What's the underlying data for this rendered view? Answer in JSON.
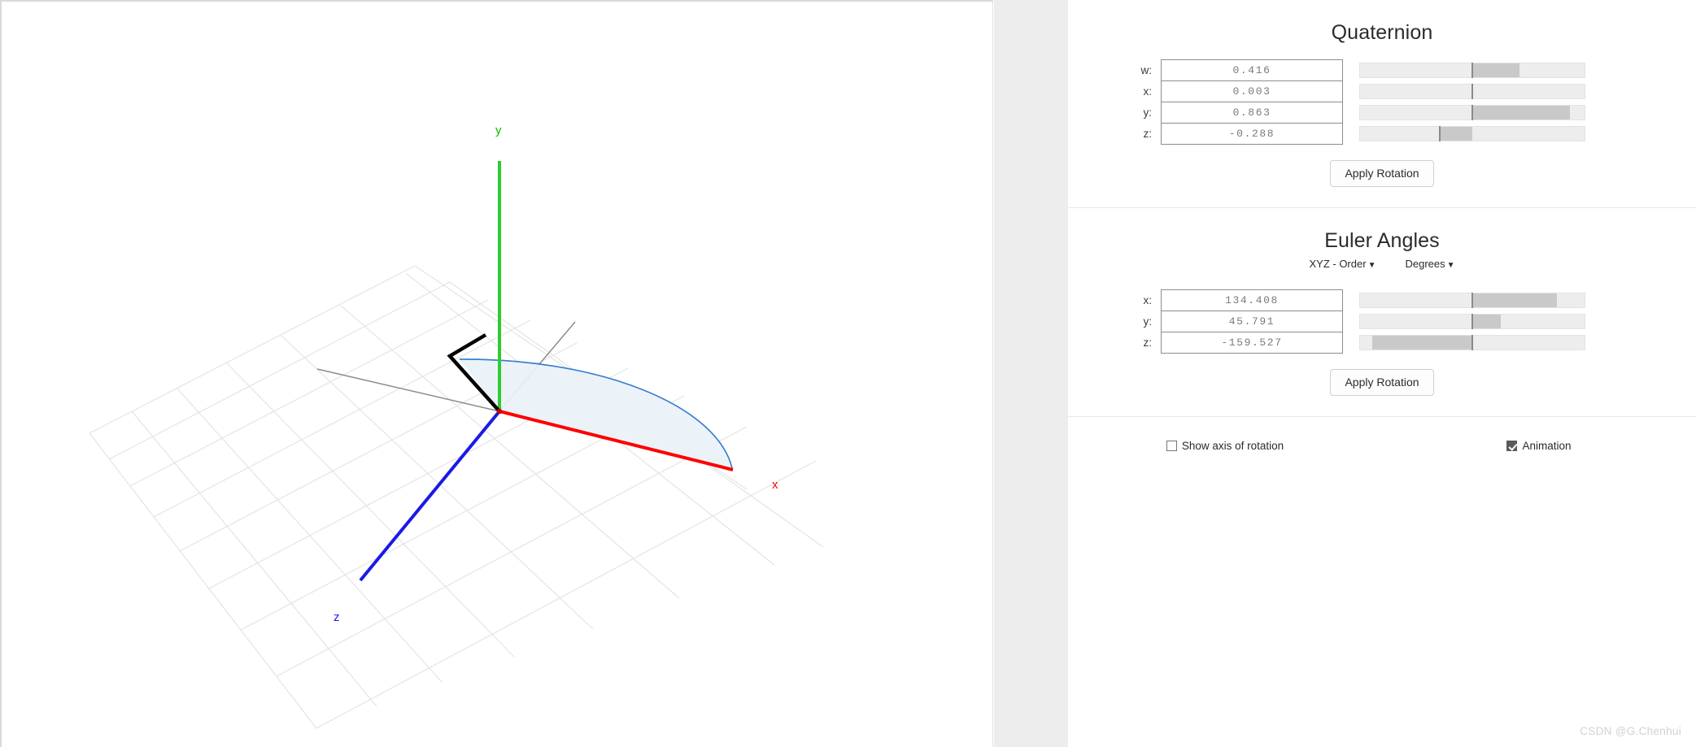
{
  "viewport": {
    "axis_labels": [
      {
        "name": "y-axis-label",
        "text": "y",
        "color": "#00c400"
      },
      {
        "name": "x-axis-label",
        "text": "x",
        "color": "#ff0000"
      },
      {
        "name": "z-axis-label",
        "text": "z",
        "color": "#2020ee"
      }
    ],
    "colors": {
      "x_axis": "#ff0000",
      "y_axis": "#2ecc2e",
      "z_axis": "#1a1ae6",
      "grid": "#e6e6e6",
      "grid_major": "#8c8c8c",
      "arc_stroke": "#3c7fd0",
      "arc_fill": "#e8f2fa",
      "rotation_vector": "#000000"
    }
  },
  "quaternion": {
    "title": "Quaternion",
    "apply_label": "Apply Rotation",
    "fields": [
      {
        "label": "w:",
        "value": "0.416",
        "num": 0.416,
        "min": -1,
        "max": 1
      },
      {
        "label": "x:",
        "value": "0.003",
        "num": 0.003,
        "min": -1,
        "max": 1
      },
      {
        "label": "y:",
        "value": "0.863",
        "num": 0.863,
        "min": -1,
        "max": 1
      },
      {
        "label": "z:",
        "value": "-0.288",
        "num": -0.288,
        "min": -1,
        "max": 1
      }
    ]
  },
  "euler": {
    "title": "Euler Angles",
    "order_label": "XYZ - Order",
    "unit_label": "Degrees",
    "apply_label": "Apply Rotation",
    "fields": [
      {
        "label": "x:",
        "value": "134.408",
        "num": 134.408,
        "min": -180,
        "max": 180
      },
      {
        "label": "y:",
        "value": "45.791",
        "num": 45.791,
        "min": -180,
        "max": 180
      },
      {
        "label": "z:",
        "value": "-159.527",
        "num": -159.527,
        "min": -180,
        "max": 180
      }
    ]
  },
  "options": {
    "show_axis_label": "Show axis of rotation",
    "show_axis_checked": false,
    "animation_label": "Animation",
    "animation_checked": true
  },
  "watermark": "CSDN @G.Chenhui"
}
